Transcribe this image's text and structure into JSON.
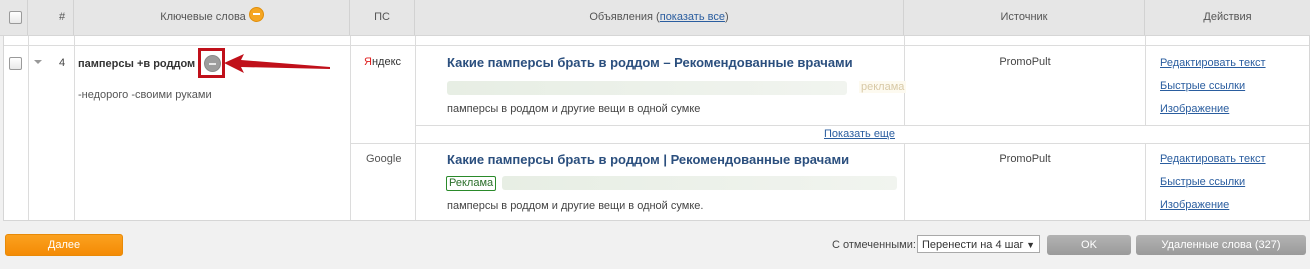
{
  "header": {
    "num": "#",
    "keywords": "Ключевые слова",
    "ps": "ПС",
    "ads_prefix": "Объявления (",
    "ads_link": "показать все",
    "ads_suffix": ")",
    "source": "Источник",
    "actions": "Действия"
  },
  "row": {
    "num": "4",
    "keyword": "памперсы +в роддом",
    "minus_words": "-недорого -своими руками",
    "show_more": "Показать еще",
    "ads": [
      {
        "engine": "Яндекс",
        "engine_first_letter": "Я",
        "engine_rest": "ндекс",
        "title": "Какие памперсы брать в роддом – Рекомендованные врачами",
        "label": "реклама",
        "text": "памперсы в роддом и другие вещи в одной сумке",
        "source": "PromoPult",
        "actions": [
          "Редактировать текст",
          "Быстрые ссылки",
          "Изображение"
        ]
      },
      {
        "engine": "Google",
        "title": "Какие памперсы брать в роддом |   Рекомендованные врачами",
        "label": "Реклама",
        "text": "памперсы в роддом и другие вещи в одной сумке.",
        "source": "PromoPult",
        "actions": [
          "Редактировать текст",
          "Быстрые ссылки",
          "Изображение"
        ]
      }
    ]
  },
  "footer": {
    "next_button": "Далее",
    "with_selected": "С отмеченными:",
    "select_value": "Перенести на 4 шаг",
    "ok_button": "OK",
    "deleted_button": "Удаленные слова (327)"
  },
  "colors": {
    "accent_orange": "#f48b05",
    "link_blue": "#2a5d9f",
    "highlight_red": "#c0101a",
    "yandex_red": "#e02020"
  }
}
